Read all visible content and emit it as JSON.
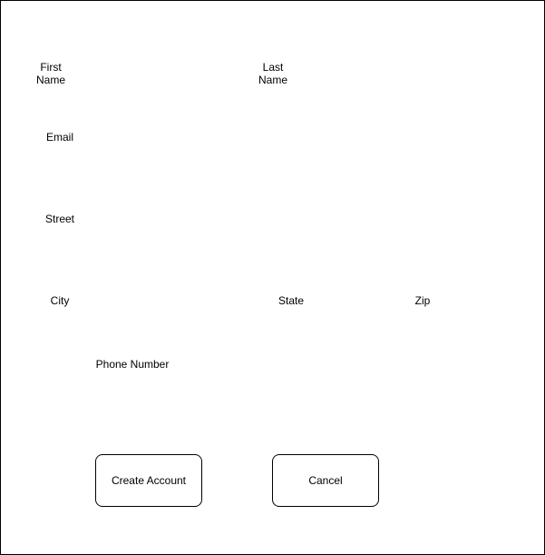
{
  "form": {
    "first_name_label": "First\nName",
    "last_name_label": "Last\nName",
    "email_label": "Email",
    "street_label": "Street",
    "city_label": "City",
    "state_label": "State",
    "zip_label": "Zip",
    "phone_label": "Phone Number"
  },
  "actions": {
    "create_account_label": "Create Account",
    "cancel_label": "Cancel"
  }
}
